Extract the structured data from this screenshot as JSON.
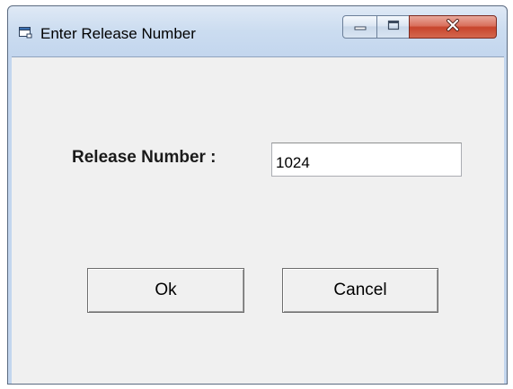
{
  "window": {
    "title": "Enter Release Number",
    "icon": "dialog-app-icon",
    "controls": {
      "minimize": "minimize-icon",
      "maximize": "maximize-icon",
      "close": "close-icon"
    }
  },
  "form": {
    "label": "Release Number :",
    "value": "1024"
  },
  "buttons": {
    "ok": "Ok",
    "cancel": "Cancel"
  },
  "colors": {
    "close_button": "#c7442c",
    "client_background": "#f0f0f0",
    "frame": "#c3d6ee"
  }
}
